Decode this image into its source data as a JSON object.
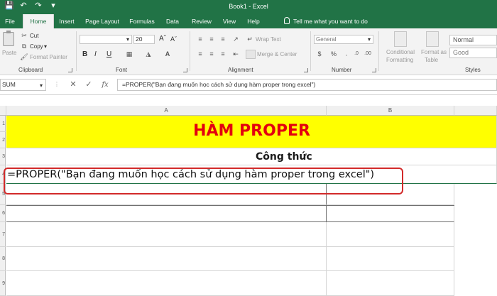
{
  "window": {
    "title": "Book1 - Excel"
  },
  "menu": {
    "tabs": [
      "File",
      "Home",
      "Insert",
      "Page Layout",
      "Formulas",
      "Data",
      "Review",
      "View",
      "Help"
    ],
    "active": "Home",
    "tell_me": "Tell me what you want to do"
  },
  "ribbon": {
    "clipboard": {
      "paste": "Paste",
      "cut": "Cut",
      "copy": "Copy",
      "format_painter": "Format Painter",
      "label": "Clipboard"
    },
    "font": {
      "size": "20",
      "label": "Font",
      "bold": "B",
      "italic": "I",
      "underline": "U"
    },
    "alignment": {
      "wrap_text": "Wrap Text",
      "merge_center": "Merge & Center",
      "label": "Alignment"
    },
    "number": {
      "format": "General",
      "label": "Number"
    },
    "styles": {
      "conditional_formatting_line1": "Conditional",
      "conditional_formatting_line2": "Formatting",
      "format_as_table_line1": "Format as",
      "format_as_table_line2": "Table",
      "normal": "Normal",
      "good": "Good",
      "label": "Styles"
    }
  },
  "formula_bar": {
    "name_box": "SUM",
    "fx": "fx",
    "formula": "=PROPER(\"Bạn đang muốn học cách sử dụng hàm proper trong excel\")"
  },
  "sheet": {
    "columns": [
      "A",
      "B"
    ],
    "rows": [
      "1",
      "2",
      "3",
      "4",
      "5",
      "6",
      "7",
      "8",
      "9"
    ],
    "title": "HÀM PROPER",
    "subtitle": "Công thức",
    "formula_cell": "=PROPER(\"Bạn đang muốn học cách sử dụng hàm proper trong excel\")"
  },
  "colors": {
    "excel_green": "#217346",
    "title_red": "#e3000f",
    "highlight_fill": "#ffff00",
    "annotation_border": "#d22a2a"
  }
}
